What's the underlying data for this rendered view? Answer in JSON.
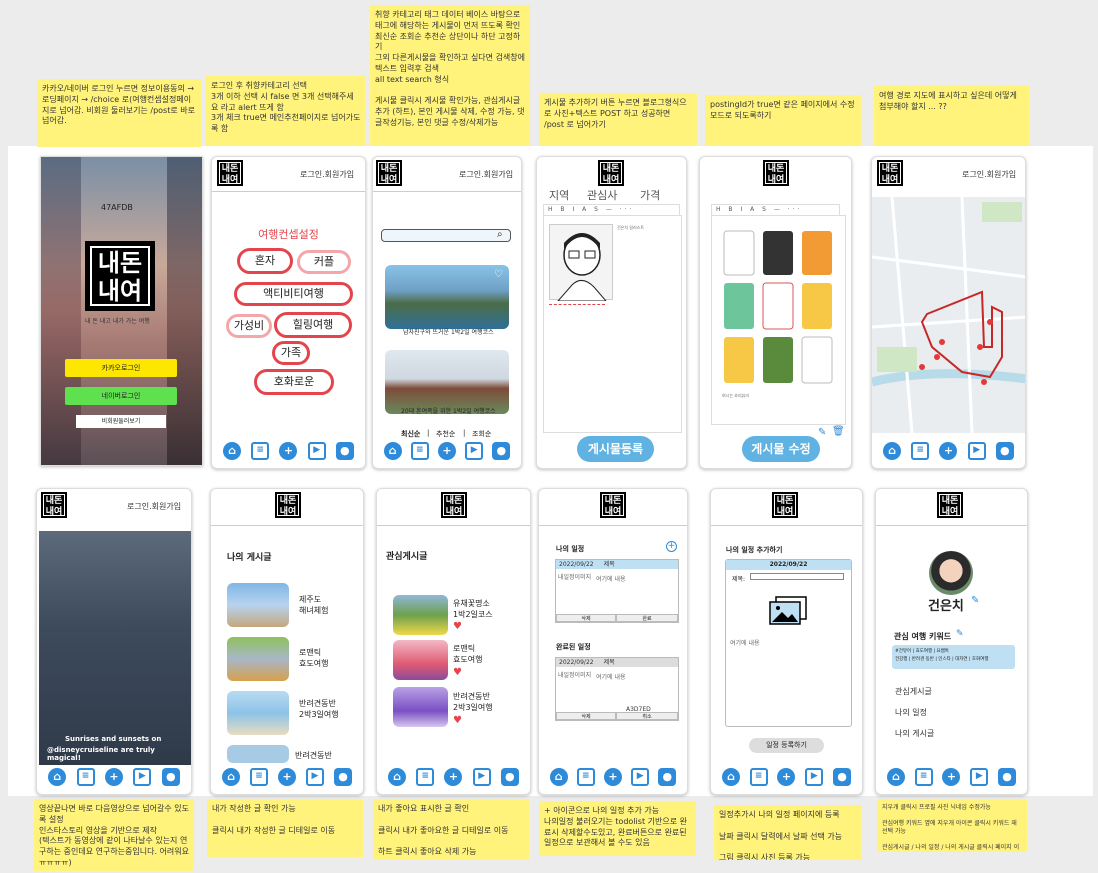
{
  "notes": {
    "top": [
      "카카오/네이버 로그인 누르면 정보이용동의 → 로딩페이지 → /choice 로(여행컨셉설정페이지로 넘어감. 비회원 둘러보기는 /post로 바로 넘어감.",
      "로그인 후 취향카테고리 선택\n3개 이하 선택 시 false 면 3개 선택해주세요 라고 alert 뜨게 함\n 3개 체크 true면 메인추천페이지로  넘어가도록 함",
      "취향 카테고리 태그 데이터 베이스 바탕으로 태그에 해당하는 게시물이 먼저 뜨도록 확인\n최신순 조회순 추천순 상단이나 하단 고정하기\n그외 다른게시물을 확인하고 싶다면 검색창에 텍스트 입력후 검색\nall text search 형식\n\n게시물 클릭시 게시물 확인가능, 관심게시글 추가 (하트), 본인 게시물 삭제, 수정 가능, 댓글작성기능, 본인 댓글 수정/삭제가능",
      "게시물 추가하기 버튼 누르면 블로그형식으로 사진+텍스트 POST 하고 성공하면 /post 로 넘어가기",
      "postingId가 true면 같은 페이지에서 수정모드로 되도록하기",
      "여행 경로 지도에 표시하고 싶은데 어떻게 첨부해야 할지 ... ??"
    ],
    "bottom": [
      "영상끝나면 바로 다음영상으로 넘어갈수 있도록 설정\n인스타스토리 영상을 기반으로 제작\n(텍스트가 동영상에 같이 나타날수 있는지 연구하는 중인데요 연구하는중입니다. 어려워요 ㅠㅠㅠㅠ)",
      "내가 작성한 글 확인 가능\n\n클릭시 내가 작성한 글 디테일로 이동",
      "내가 좋아요 표시한 글 확인\n\n클릭시 내가 좋아요한 글 디테일로 이동\n\n하트 클릭시 좋아요 삭제 가능",
      "+ 아이콘으로 나의 일정 추가 가능\n나의일정 불러오기는 todolist 기반으로 완료시 삭제할수도있고, 완료버튼으로 완료된 일정으로 보관해서 볼 수도 있음",
      "일정추가시 나의 일정 페이지에 등록\n\n날짜 클릭시 달력에서 날짜 선택 가능\n\n그림 클릭시 사진 등록 가능",
      "지우개 클릭시 프로필 사진 닉네임 수정가능\n\n관심여행 키워드 옆에 지우개 아이콘 클릭시 키워드 재선택 가능\n\n관심게시글 / 나의 일정 / 나의 게시글 클릭시 페이지 이동"
    ]
  },
  "common": {
    "logo_text": "내돈\n내여",
    "login_link": "로그인.회원가입",
    "nav_icons": [
      "home-icon",
      "list-icon",
      "plus-icon",
      "video-icon",
      "user-icon"
    ]
  },
  "screen1": {
    "code": "47AFDB",
    "logo": "내돈\n내여",
    "subtitle": "내 돈 내고 내가 가는 여행",
    "kakao": "카카오로그인",
    "naver": "네이버로그인",
    "guest": "비회원둘러보기"
  },
  "screen2": {
    "title": "여행컨셉설정",
    "tags": [
      "혼자",
      "커플",
      "액티비티여행",
      "가성비",
      "힐링여행",
      "가족",
      "호화로운"
    ]
  },
  "screen3": {
    "search_placeholder": "",
    "posts": [
      "남자친구와 뜨거운 1박2일 여행코스",
      "20대 혼여족을 위한 1박2일 여행코스"
    ],
    "sort": [
      "최신순",
      "추천순",
      "조회순"
    ]
  },
  "screen4": {
    "filters": [
      "지역",
      "관심사",
      "가격"
    ],
    "toolbar": "H B I A S — ···",
    "image_caption": "건은치 일러스트",
    "submit": "게시물등록"
  },
  "screen5": {
    "toolbar": "H B I A S — ···",
    "caption": "여시는 흐리뷰러",
    "submit": "게시물 수정"
  },
  "screen7": {
    "overlay1": "Sunrises and sunsets on",
    "overlay2": "@disneycruiseline are truly magical!"
  },
  "screen8": {
    "title": "나의 게시글",
    "items": [
      "제주도\n해녀체험",
      "로맨틱\n효도여행",
      "반려견동반\n2박3일여행",
      "반려견동반"
    ]
  },
  "screen9": {
    "title": "관심게시글",
    "items": [
      "유채꽃명소\n1박2일코스",
      "로맨틱\n효도여행",
      "반려견동반\n2박3일여행"
    ]
  },
  "screen10": {
    "my_schedule": "나의 일정",
    "done_schedule": "완료된 일정",
    "date1": "2022/09/22",
    "title_label": "제목",
    "img_alt": "내일정이미지",
    "content": "여기에 내용",
    "btn_delete": "삭제",
    "btn_done": "완료",
    "btn_cancel": "취소",
    "code": "A3D7ED"
  },
  "screen11": {
    "title": "나의 일정 추가하기",
    "date": "2022/09/22",
    "title_label": "제목:",
    "content": "여기에 내용",
    "submit": "일정 등록하기"
  },
  "screen12": {
    "name": "건은치",
    "keyword_title": "관심 여행 키워드",
    "keywords_row1": "#건뮤어 | 효도여행 | 요쌤톡",
    "keywords_row2": "건강행 | 반려견 동반 | 인스타 | 대자연 | 호화여행",
    "menu": [
      "관심게시글",
      "나의 일정",
      "나의 게시글"
    ]
  }
}
